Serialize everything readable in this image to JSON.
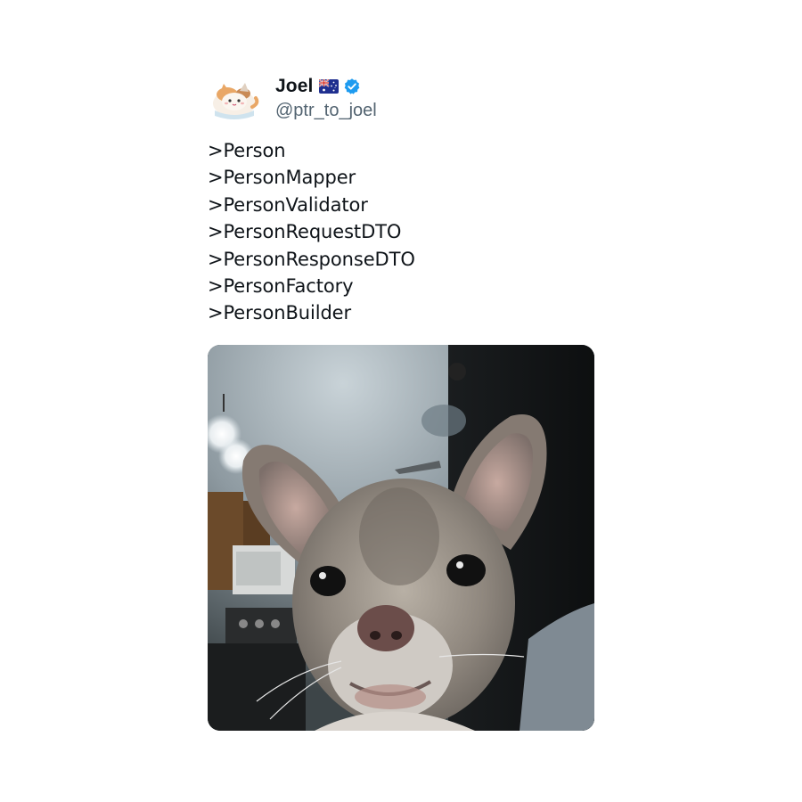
{
  "tweet": {
    "author": {
      "display_name": "Joel",
      "handle": "@ptr_to_joel",
      "flag_icon": "australia-flag-icon",
      "verified_icon": "verified-badge-icon",
      "verified_color": "#1d9bf0",
      "avatar_icon": "cat-avatar-icon"
    },
    "lines": [
      ">Person",
      ">PersonMapper",
      ">PersonValidator",
      ">PersonRequestDTO",
      ">PersonResponseDTO",
      ">PersonFactory",
      ">PersonBuilder"
    ],
    "media": {
      "type": "photo",
      "icon": "chihuahua-photo"
    }
  }
}
